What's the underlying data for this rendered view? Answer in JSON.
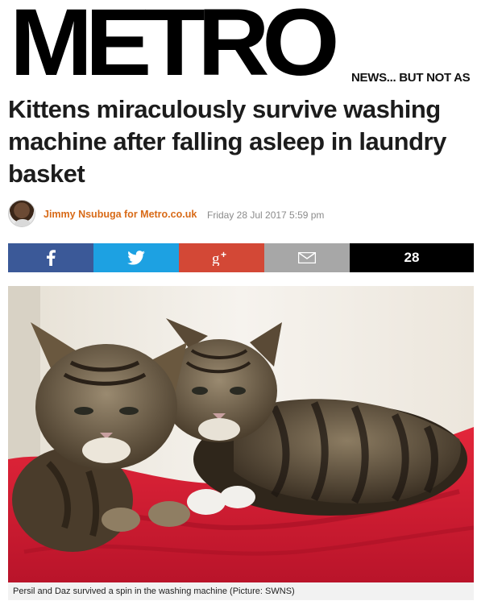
{
  "masthead": {
    "logo": "METRO",
    "tagline": "NEWS... BUT NOT AS"
  },
  "article": {
    "headline": "Kittens miraculously survive washing machine after falling asleep in laundry basket",
    "author": "Jimmy Nsubuga for Metro.co.uk",
    "date": "Friday 28 Jul 2017 5:59 pm"
  },
  "share_bar": {
    "count": "28",
    "facebook_icon": "facebook-icon",
    "twitter_icon": "twitter-icon",
    "googleplus_icon": "google-plus-icon",
    "email_icon": "email-icon",
    "colors": {
      "facebook": "#3b5998",
      "twitter": "#1da1e2",
      "googleplus": "#d34836",
      "email": "#a7a7a7",
      "count": "#000000"
    }
  },
  "image": {
    "caption": "Persil and Daz survived a spin in the washing machine (Picture: SWNS)"
  },
  "colors": {
    "author": "#d86a17",
    "date": "#8b8b8b"
  }
}
